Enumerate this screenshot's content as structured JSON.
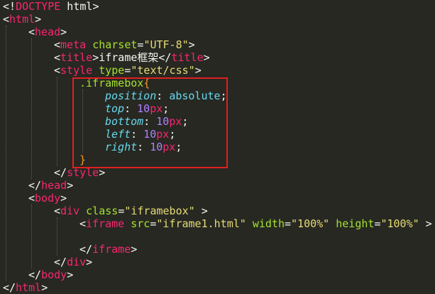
{
  "lines": {
    "l1": {
      "a": "<!",
      "b": "DOCTYPE",
      "c": " html",
      "d": ">"
    },
    "l2": {
      "a": "<",
      "b": "html",
      "c": ">"
    },
    "l3": {
      "a": "<",
      "b": "head",
      "c": ">"
    },
    "l4": {
      "a": "<",
      "b": "meta",
      "c": " ",
      "d": "charset",
      "e": "=",
      "f": "\"UTF-8\"",
      "g": ">"
    },
    "l5": {
      "a": "<",
      "b": "title",
      "c": ">",
      "d": "iframe框架",
      "e": "</",
      "f": "title",
      "g": ">"
    },
    "l6": {
      "a": "<",
      "b": "style",
      "c": " ",
      "d": "type",
      "e": "=",
      "f": "\"text/css\"",
      "g": ">"
    },
    "l7": {
      "sel": ".iframebox",
      "brace": "{"
    },
    "l8": {
      "prop": "position",
      "colon": ": ",
      "val": "absolute",
      "semi": ";"
    },
    "l9": {
      "prop": "top",
      "colon": ": ",
      "num": "10",
      "unit": "px",
      "semi": ";"
    },
    "l10": {
      "prop": "bottom",
      "colon": ": ",
      "num": "10",
      "unit": "px",
      "semi": ";"
    },
    "l11": {
      "prop": "left",
      "colon": ": ",
      "num": "10",
      "unit": "px",
      "semi": ";"
    },
    "l12": {
      "prop": "right",
      "colon": ": ",
      "num": "10",
      "unit": "px",
      "semi": ";"
    },
    "l13": {
      "brace": "}"
    },
    "l14": {
      "a": "</",
      "b": "style",
      "c": ">"
    },
    "l15": {
      "a": "</",
      "b": "head",
      "c": ">"
    },
    "l16": {
      "a": "<",
      "b": "body",
      "c": ">"
    },
    "l17": {
      "a": "<",
      "b": "div",
      "c": " ",
      "d": "class",
      "e": "=",
      "f": "\"iframebox\"",
      "g": " >"
    },
    "l18": {
      "a": "<",
      "b": "iframe",
      "c": " ",
      "d": "src",
      "e": "=",
      "f": "\"iframe1.html\"",
      "g": " ",
      "h": "width",
      "i": "=",
      "j": "\"100%\"",
      "k": " ",
      "l": "height",
      "m": "=",
      "n": "\"100%\"",
      "o": " >"
    },
    "l19": {
      "a": "</",
      "b": "iframe",
      "c": ">"
    },
    "l20": {
      "a": "</",
      "b": "div",
      "c": ">"
    },
    "l21": {
      "a": "</",
      "b": "body",
      "c": ">"
    },
    "l22": {
      "a": "</",
      "b": "html",
      "c": ">"
    }
  },
  "colors": {
    "background": "#272822",
    "tag": "#f92672",
    "string": "#e6db74",
    "attribute": "#a6e22e",
    "property": "#66d9ef",
    "number": "#ae81ff",
    "highlight_box": "#e02020"
  }
}
